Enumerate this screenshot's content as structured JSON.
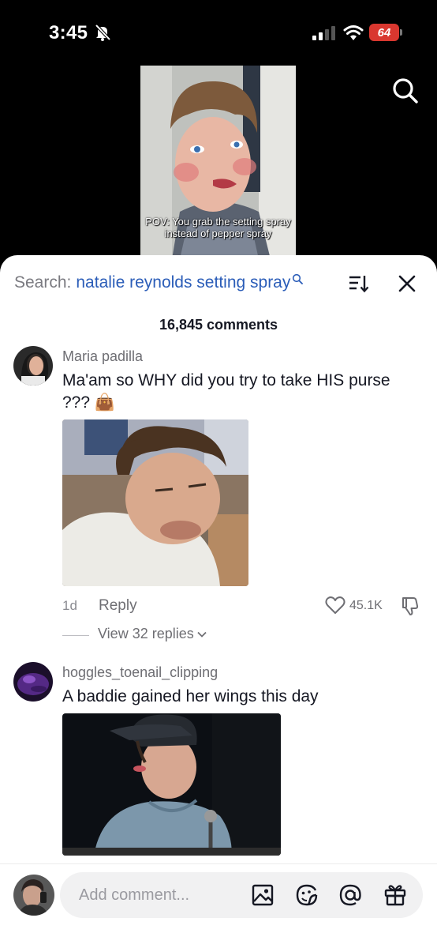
{
  "status_bar": {
    "time": "3:45",
    "battery": "64",
    "battery_color": "#d9372f"
  },
  "video": {
    "caption": "POV: You grab the setting spray instead of pepper spray"
  },
  "search": {
    "prefix": "Search:",
    "query": "natalie reynolds setting spray"
  },
  "comments_header": {
    "count_label": "16,845 comments"
  },
  "comments": [
    {
      "username": "Maria padilla",
      "text": "Ma'am so WHY did you try to take HIS purse ??? 👜",
      "age": "1d",
      "reply_label": "Reply",
      "likes": "45.1K",
      "view_replies": "View 32 replies"
    },
    {
      "username": "hoggles_toenail_clipping",
      "text": "A baddie gained her wings this day"
    }
  ],
  "composer": {
    "placeholder": "Add comment..."
  },
  "icons": {
    "top_search": "search-icon",
    "sort": "sort-icon",
    "close": "close-icon",
    "like": "heart-icon",
    "dislike": "thumbs-down-icon",
    "image": "image-icon",
    "emoji": "emoji-icon",
    "mention": "at-mention-icon",
    "gift": "gift-icon"
  },
  "colors": {
    "accent_link": "#2b5db8",
    "sheet_background": "#ffffff",
    "app_background": "#000000"
  }
}
